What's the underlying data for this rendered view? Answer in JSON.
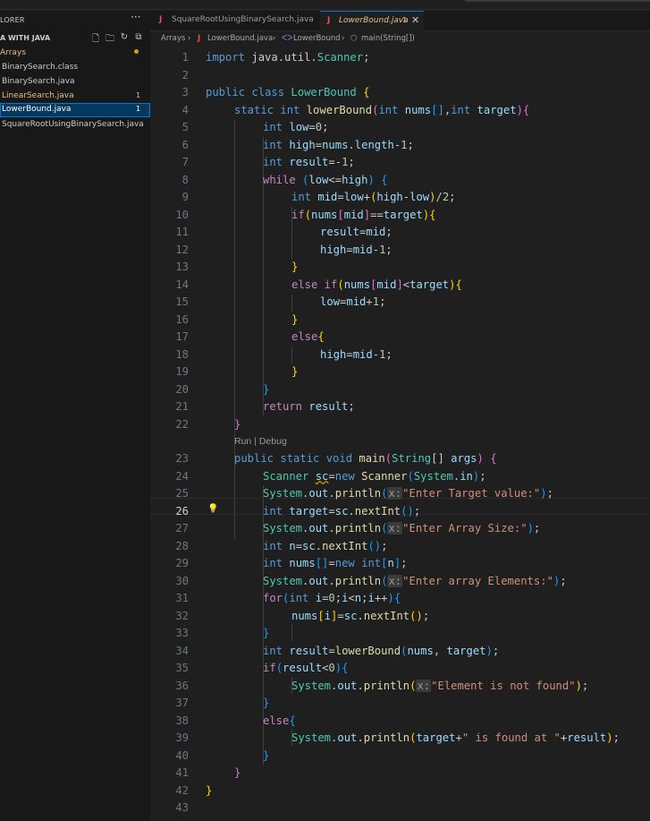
{
  "explorer": {
    "title": "LORER",
    "more": "···",
    "folder": "A WITH JAVA",
    "files": [
      {
        "name": "Arrays",
        "badge": "",
        "color": "#e2c08d"
      },
      {
        "name": "BinarySearch.class",
        "badge": "",
        "color": "#cccccc"
      },
      {
        "name": "BinarySearch.java",
        "badge": "",
        "color": "#cccccc"
      },
      {
        "name": "LinearSearch.java",
        "badge": "1",
        "color": "#e2c08d"
      },
      {
        "name": "LowerBound.java",
        "badge": "1",
        "color": "#ffffff"
      },
      {
        "name": "SquareRootUsingBinarySearch.java",
        "badge": "",
        "color": "#cccccc"
      }
    ]
  },
  "tabs": [
    {
      "icon": "J",
      "label": "SquareRootUsingBinarySearch.java"
    },
    {
      "icon": "J",
      "label": "LowerBound.java",
      "badge": "1",
      "close": "✕"
    }
  ],
  "breadcrumb": {
    "folder": "Arrays",
    "file_icon": "J",
    "file": "LowerBound.java",
    "class": "LowerBound",
    "method": "main(String[])"
  },
  "codelens": {
    "run": "Run",
    "sep": "|",
    "debug": "Debug"
  },
  "line_numbers": [
    "1",
    "2",
    "3",
    "4",
    "5",
    "6",
    "7",
    "8",
    "9",
    "10",
    "11",
    "12",
    "13",
    "14",
    "15",
    "16",
    "17",
    "18",
    "19",
    "20",
    "21",
    "22",
    "23",
    "24",
    "25",
    "26",
    "27",
    "28",
    "29",
    "30",
    "31",
    "32",
    "33",
    "34",
    "35",
    "36",
    "37",
    "38",
    "39",
    "40",
    "41",
    "42",
    "43"
  ],
  "code": {
    "l1_a": "import",
    "l1_b": " java.util.",
    "l1_c": "Scanner",
    "l1_d": ";",
    "l3_a": "public class ",
    "l3_b": "LowerBound",
    "l3_c": " {",
    "l4_a": "static int ",
    "l4_b": "lowerBound",
    "l4_c": "(",
    "l4_d": "int ",
    "l4_e": "nums",
    "l4_f": "[]",
    "l4_g": ",",
    "l4_h": "int ",
    "l4_i": "target",
    "l4_j": ")",
    "l4_k": "{",
    "l5_a": "int ",
    "l5_b": "low",
    "l5_c": "=",
    "l5_d": "0",
    "l5_e": ";",
    "l6_a": "int ",
    "l6_b": "high",
    "l6_c": "=",
    "l6_d": "nums",
    "l6_e": ".",
    "l6_f": "length",
    "l6_g": "-",
    "l6_h": "1",
    "l6_i": ";",
    "l7_a": "int ",
    "l7_b": "result",
    "l7_c": "=-",
    "l7_d": "1",
    "l7_e": ";",
    "l8_a": "while",
    "l8_b": " (",
    "l8_c": "low",
    "l8_d": "<=",
    "l8_e": "high",
    "l8_f": ")",
    "l8_g": " {",
    "l9_a": "int ",
    "l9_b": "mid",
    "l9_c": "=",
    "l9_d": "low",
    "l9_e": "+",
    "l9_f": "(",
    "l9_g": "high",
    "l9_h": "-",
    "l9_i": "low",
    "l9_j": ")",
    "l9_k": "/",
    "l9_l": "2",
    "l9_m": ";",
    "l10_a": "if",
    "l10_b": "(",
    "l10_c": "nums",
    "l10_d": "[",
    "l10_e": "mid",
    "l10_f": "]",
    "l10_g": "==",
    "l10_h": "target",
    "l10_i": ")",
    "l10_j": "{",
    "l11_a": "result",
    "l11_b": "=",
    "l11_c": "mid",
    "l11_d": ";",
    "l12_a": "high",
    "l12_b": "=",
    "l12_c": "mid",
    "l12_d": "-",
    "l12_e": "1",
    "l12_f": ";",
    "l13": "}",
    "l14_a": "else if",
    "l14_b": "(",
    "l14_c": "nums",
    "l14_d": "[",
    "l14_e": "mid",
    "l14_f": "]",
    "l14_g": "<",
    "l14_h": "target",
    "l14_i": ")",
    "l14_j": "{",
    "l15_a": "low",
    "l15_b": "=",
    "l15_c": "mid",
    "l15_d": "+",
    "l15_e": "1",
    "l15_f": ";",
    "l16": "}",
    "l17_a": "else",
    "l17_b": "{",
    "l18_a": "high",
    "l18_b": "=",
    "l18_c": "mid",
    "l18_d": "-",
    "l18_e": "1",
    "l18_f": ";",
    "l19": "}",
    "l20": "}",
    "l21_a": "return",
    "l21_b": " result",
    "l21_c": ";",
    "l22": "}",
    "l23_a": "public static void ",
    "l23_b": "main",
    "l23_c": "(",
    "l23_d": "String",
    "l23_e": "[] ",
    "l23_f": "args",
    "l23_g": ")",
    "l23_h": " {",
    "l24_a": "Scanner ",
    "l24_b": "sc",
    "l24_c": "=",
    "l24_d": "new ",
    "l24_e": "Scanner",
    "l24_f": "(",
    "l24_g": "System",
    "l24_h": ".",
    "l24_i": "in",
    "l24_j": ")",
    "l24_k": ";",
    "l25_a": "System",
    "l25_b": ".",
    "l25_c": "out",
    "l25_d": ".",
    "l25_e": "println",
    "l25_f": "(",
    "l25_g": "x:",
    "l25_h": "\"Enter Target value:\"",
    "l25_i": ")",
    "l25_j": ";",
    "l26_a": "int ",
    "l26_b": "target",
    "l26_c": "=",
    "l26_d": "sc",
    "l26_e": ".",
    "l26_f": "nextInt",
    "l26_g": "()",
    "l26_h": ";",
    "l27_a": "System",
    "l27_b": ".",
    "l27_c": "out",
    "l27_d": ".",
    "l27_e": "println",
    "l27_f": "(",
    "l27_g": "x:",
    "l27_h": "\"Enter Array Size:\"",
    "l27_i": ")",
    "l27_j": ";",
    "l28_a": "int ",
    "l28_b": "n",
    "l28_c": "=",
    "l28_d": "sc",
    "l28_e": ".",
    "l28_f": "nextInt",
    "l28_g": "()",
    "l28_h": ";",
    "l29_a": "int ",
    "l29_b": "nums",
    "l29_c": "[]",
    "l29_d": "=",
    "l29_e": "new ",
    "l29_f": "int",
    "l29_g": "[",
    "l29_h": "n",
    "l29_i": "]",
    "l29_j": ";",
    "l30_a": "System",
    "l30_b": ".",
    "l30_c": "out",
    "l30_d": ".",
    "l30_e": "println",
    "l30_f": "(",
    "l30_g": "x:",
    "l30_h": "\"Enter array Elements:\"",
    "l30_i": ")",
    "l30_j": ";",
    "l31_a": "for",
    "l31_b": "(",
    "l31_c": "int ",
    "l31_d": "i",
    "l31_e": "=",
    "l31_f": "0",
    "l31_g": ";",
    "l31_h": "i",
    "l31_i": "<",
    "l31_j": "n",
    "l31_k": ";",
    "l31_l": "i",
    "l31_m": "++",
    "l31_n": ")",
    "l31_o": "{",
    "l32_a": "nums",
    "l32_b": "[",
    "l32_c": "i",
    "l32_d": "]",
    "l32_e": "=",
    "l32_f": "sc",
    "l32_g": ".",
    "l32_h": "nextInt",
    "l32_i": "()",
    "l32_j": ";",
    "l33": "}",
    "l34_a": "int ",
    "l34_b": "result",
    "l34_c": "=",
    "l34_d": "lowerBound",
    "l34_e": "(",
    "l34_f": "nums",
    "l34_g": ", ",
    "l34_h": "target",
    "l34_i": ")",
    "l34_j": ";",
    "l35_a": "if",
    "l35_b": "(",
    "l35_c": "result",
    "l35_d": "<",
    "l35_e": "0",
    "l35_f": ")",
    "l35_g": "{",
    "l36_a": "System",
    "l36_b": ".",
    "l36_c": "out",
    "l36_d": ".",
    "l36_e": "println",
    "l36_f": "(",
    "l36_g": "x:",
    "l36_h": "\"Element is not found\"",
    "l36_i": ")",
    "l36_j": ";",
    "l37": "}",
    "l38_a": "else",
    "l38_b": "{",
    "l39_a": "System",
    "l39_b": ".",
    "l39_c": "out",
    "l39_d": ".",
    "l39_e": "println",
    "l39_f": "(",
    "l39_g": "target",
    "l39_h": "+",
    "l39_i": "\" is found at \"",
    "l39_j": "+",
    "l39_k": "result",
    "l39_l": ")",
    "l39_m": ";",
    "l40": "}",
    "l41": "}",
    "l42": "}"
  }
}
